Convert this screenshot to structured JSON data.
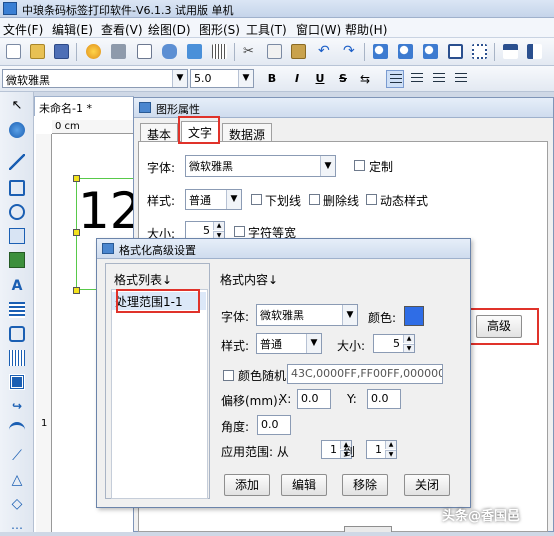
{
  "app": {
    "title": "中琅条码标签打印软件-V6.1.3 试用版 单机"
  },
  "menu": [
    "文件(F)",
    "编辑(E)",
    "查看(V)",
    "绘图(D)",
    "图形(S)",
    "工具(T)",
    "窗口(W)",
    "帮助(H)"
  ],
  "font_toolbar": {
    "font": "微软雅黑",
    "size": "5.0",
    "bold": "B",
    "italic": "I",
    "underline": "U",
    "strike": "S"
  },
  "document": {
    "tab_label": "未命名-1 *",
    "ruler_unit": "0 cm",
    "ruler_v_mark": "1",
    "preview_text": "12"
  },
  "props": {
    "title": "图形属性",
    "tabs": [
      "基本",
      "文字",
      "数据源"
    ],
    "font_label": "字体:",
    "font_value": "微软雅黑",
    "custom_label": "定制",
    "style_label": "样式:",
    "style_value": "普通",
    "underline": "下划线",
    "strikethrough": "删除线",
    "dynamic_style": "动态样式",
    "size_label": "大小:",
    "size_value": "5",
    "monospace": "字符等宽",
    "advanced_button": "高级"
  },
  "fmt": {
    "title": "格式化高级设置",
    "list_header": "格式列表↓",
    "list_items": [
      "处理范围1-1"
    ],
    "content_header": "格式内容↓",
    "font_label": "字体:",
    "font_value": "微软雅黑",
    "color_label": "颜色:",
    "color_value": "#2f6de6",
    "style_label": "样式:",
    "style_value": "普通",
    "size_label": "大小:",
    "size_value": "5",
    "random_color": "颜色随机",
    "random_colors_value": "43C,0000FF,FF00FF,000000",
    "offset_label": "偏移(mm):",
    "x_label": "X:",
    "x_value": "0.0",
    "y_label": "Y:",
    "y_value": "0.0",
    "angle_label": "角度:",
    "angle_value": "0.0",
    "range_label": "应用范围: 从",
    "range_from": "1",
    "range_to_label": "到",
    "range_to": "1",
    "buttons": {
      "add": "添加",
      "edit": "编辑",
      "remove": "移除",
      "close": "关闭"
    }
  },
  "watermark": "头条@香国邑"
}
